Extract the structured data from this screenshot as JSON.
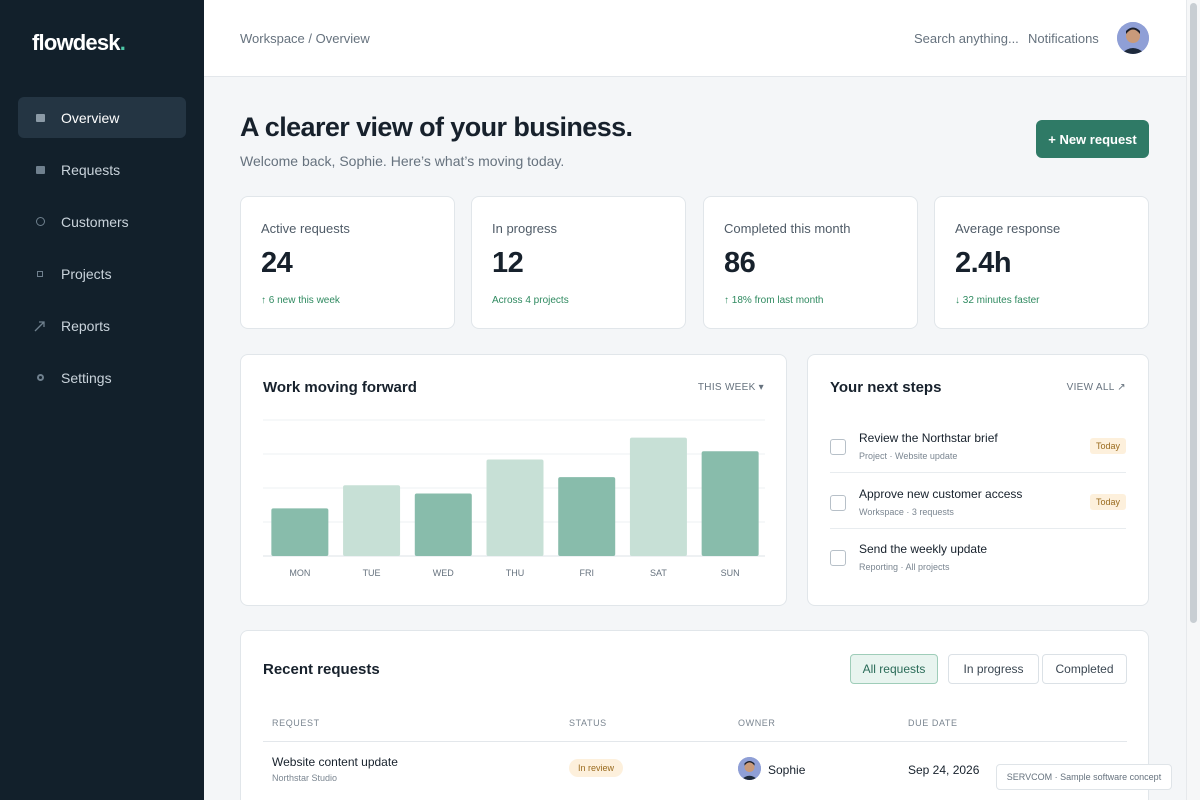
{
  "app": {
    "name": "flowdesk",
    "dot": "."
  },
  "sidebar": {
    "items": [
      {
        "label": "Overview",
        "icon": "overview-icon",
        "active": true
      },
      {
        "label": "Requests",
        "icon": "requests-icon"
      },
      {
        "label": "Customers",
        "icon": "customers-icon"
      },
      {
        "label": "Projects",
        "icon": "projects-icon"
      },
      {
        "label": "Reports",
        "icon": "reports-icon"
      },
      {
        "label": "Settings",
        "icon": "settings-icon"
      }
    ]
  },
  "topbar": {
    "breadcrumb": "Workspace / Overview",
    "search_placeholder": "Search anything...",
    "notifications_label": "Notifications"
  },
  "header": {
    "title": "A clearer view of your business.",
    "subtitle": "Welcome back, Sophie. Here’s what’s moving today.",
    "new_request_label": "+ New request"
  },
  "stats": [
    {
      "label": "Active requests",
      "value": "24",
      "note": "↑ 6 new this week"
    },
    {
      "label": "In progress",
      "value": "12",
      "note": "Across 4 projects"
    },
    {
      "label": "Completed this month",
      "value": "86",
      "note": "↑ 18% from last month"
    },
    {
      "label": "Average response",
      "value": "2.4h",
      "note": "↓ 32 minutes faster"
    }
  ],
  "chart_panel": {
    "title": "Work moving forward",
    "range_label": "THIS WEEK ▾"
  },
  "chart_data": {
    "type": "bar",
    "title": "Work moving forward",
    "categories": [
      "MON",
      "TUE",
      "WED",
      "THU",
      "FRI",
      "SAT",
      "SUN"
    ],
    "values": [
      35,
      52,
      46,
      71,
      58,
      87,
      77
    ],
    "ylim": [
      0,
      100
    ],
    "grid": true,
    "colors": [
      "#88bcab",
      "#c7e0d6",
      "#88bcab",
      "#c7e0d6",
      "#88bcab",
      "#c7e0d6",
      "#88bcab"
    ]
  },
  "steps_panel": {
    "title": "Your next steps",
    "view_all_label": "VIEW ALL ↗",
    "items": [
      {
        "title": "Review the Northstar brief",
        "meta": "Project · Website update",
        "badge": "Today"
      },
      {
        "title": "Approve new customer access",
        "meta": "Workspace · 3 requests",
        "badge": "Today"
      },
      {
        "title": "Send the weekly update",
        "meta": "Reporting · All projects",
        "badge": ""
      }
    ]
  },
  "requests_panel": {
    "title": "Recent requests",
    "filters": [
      "All requests",
      "In progress",
      "Completed"
    ],
    "columns": [
      "REQUEST",
      "STATUS",
      "OWNER",
      "DUE DATE"
    ],
    "rows": [
      {
        "title": "Website content update",
        "client": "Northstar Studio",
        "status": "In review",
        "owner": "Sophie",
        "due": "Sep 24, 2026"
      }
    ]
  },
  "footer_note": "SERVCOM · Sample software concept",
  "colors": {
    "accent": "#2f7a66",
    "sidebar_bg": "#12202b",
    "positive": "#2f8a60"
  }
}
